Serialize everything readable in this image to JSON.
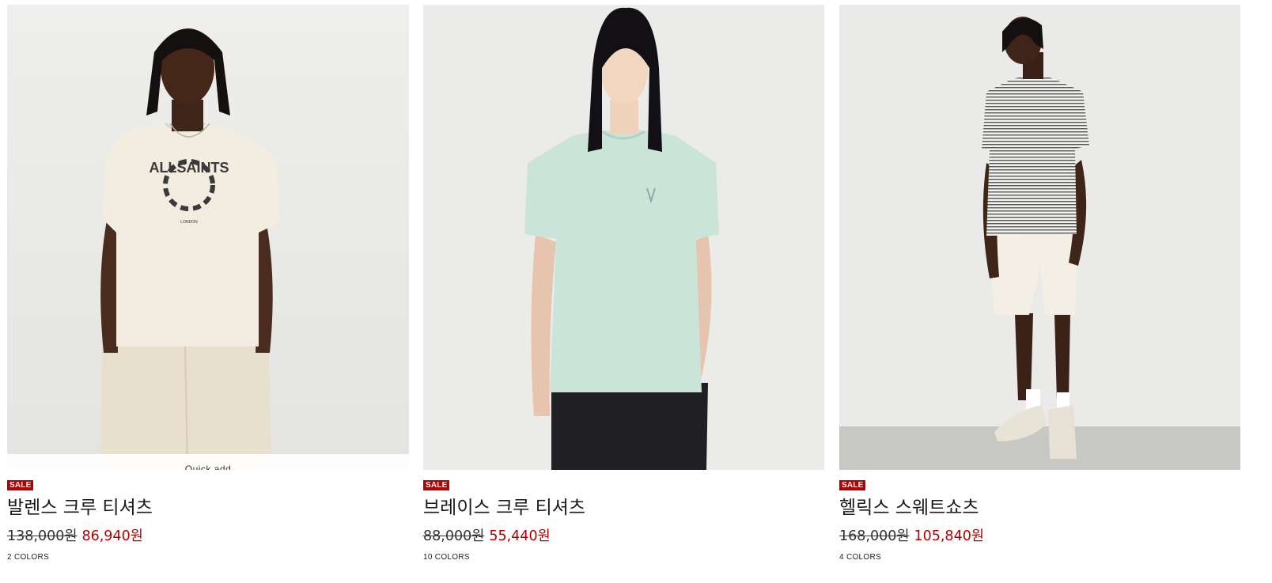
{
  "products": [
    {
      "badge": "SALE",
      "name": "발렌스 크루 티셔츠",
      "original_price": "138,000원",
      "sale_price": "86,940원",
      "colors": "2 COLORS",
      "quick_add": "Quick add",
      "image_subject": "model in cream t-shirt with circular SAINT ALLSAINTS print",
      "graphic_text": "ALLSAINTS",
      "graphic_subtext": "LONDON"
    },
    {
      "badge": "SALE",
      "name": "브레이스 크루 티셔츠",
      "original_price": "88,000원",
      "sale_price": "55,440원",
      "colors": "10 COLORS",
      "image_subject": "model in mint crew t-shirt with small ram logo"
    },
    {
      "badge": "SALE",
      "name": "헬릭스 스웨트쇼츠",
      "original_price": "168,000원",
      "sale_price": "105,840원",
      "colors": "4 COLORS",
      "image_subject": "model in striped tee and cream sweat shorts, white sneakers"
    }
  ],
  "colors": {
    "sale_red": "#b30000",
    "text": "#1a1a1a",
    "photo_bg": "#ececea"
  }
}
